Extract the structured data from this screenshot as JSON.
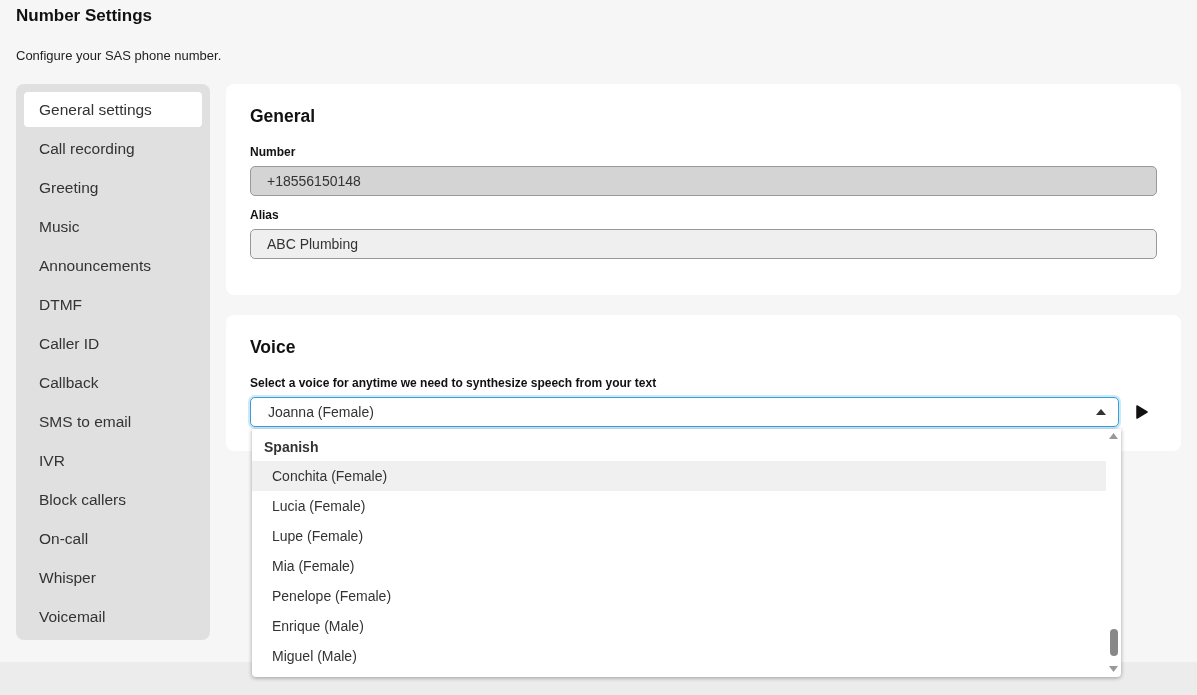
{
  "page": {
    "title": "Number Settings",
    "subtitle": "Configure your SAS phone number."
  },
  "sidebar": {
    "items": [
      {
        "label": "General settings",
        "selected": true
      },
      {
        "label": "Call recording",
        "selected": false
      },
      {
        "label": "Greeting",
        "selected": false
      },
      {
        "label": "Music",
        "selected": false
      },
      {
        "label": "Announcements",
        "selected": false
      },
      {
        "label": "DTMF",
        "selected": false
      },
      {
        "label": "Caller ID",
        "selected": false
      },
      {
        "label": "Callback",
        "selected": false
      },
      {
        "label": "SMS to email",
        "selected": false
      },
      {
        "label": "IVR",
        "selected": false
      },
      {
        "label": "Block callers",
        "selected": false
      },
      {
        "label": "On-call",
        "selected": false
      },
      {
        "label": "Whisper",
        "selected": false
      },
      {
        "label": "Voicemail",
        "selected": false
      }
    ]
  },
  "general": {
    "title": "General",
    "fields": [
      {
        "label": "Number",
        "value": "+18556150148",
        "disabled": true
      },
      {
        "label": "Alias",
        "value": "ABC Plumbing",
        "disabled": false
      }
    ]
  },
  "voice": {
    "title": "Voice",
    "label": "Select a voice for anytime we need to synthesize speech from your text",
    "value": "Joanna (Female)",
    "expanded": true,
    "dropdown": {
      "group": "Spanish",
      "options": [
        {
          "label": "Conchita (Female)",
          "selected": true
        },
        {
          "label": "Lucia (Female)",
          "selected": false
        },
        {
          "label": "Lupe (Female)",
          "selected": false
        },
        {
          "label": "Mia (Female)",
          "selected": false
        },
        {
          "label": "Penelope (Female)",
          "selected": false
        },
        {
          "label": "Enrique (Male)",
          "selected": false
        },
        {
          "label": "Miguel (Male)",
          "selected": false
        }
      ]
    }
  }
}
